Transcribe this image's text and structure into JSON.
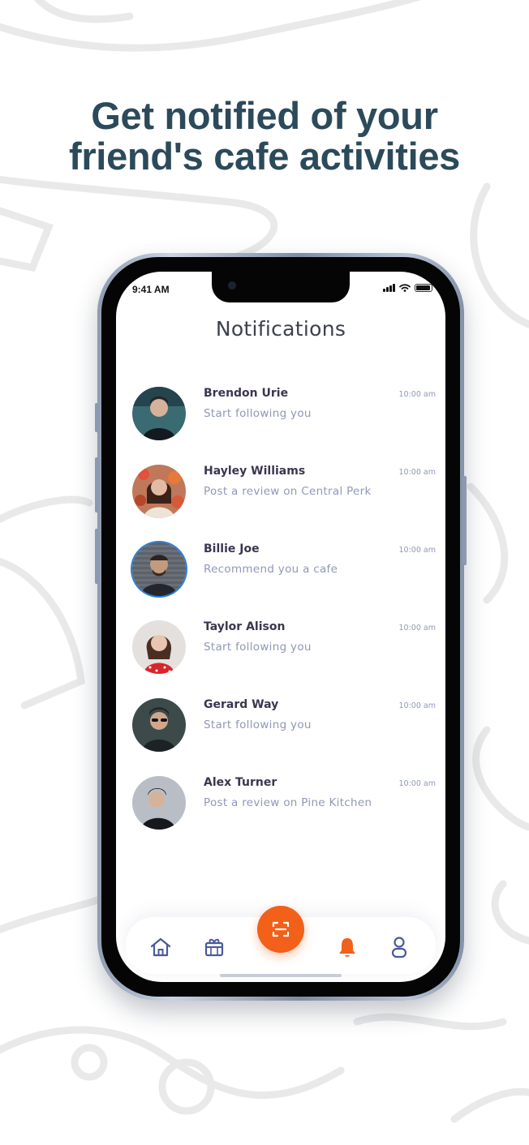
{
  "headline": {
    "line1": "Get notified of your",
    "line2": "friend's cafe activities"
  },
  "status_bar": {
    "time": "9:41 AM"
  },
  "screen": {
    "title": "Notifications"
  },
  "notifications": [
    {
      "name": "Brendon Urie",
      "message": "Start following you",
      "time": "10:00 am",
      "avatar": "person-portrait"
    },
    {
      "name": "Hayley Williams",
      "message": "Post a review on Central Perk",
      "time": "10:00 am",
      "avatar": "person-portrait"
    },
    {
      "name": "Billie Joe",
      "message": "Recommend you a cafe",
      "time": "10:00 am",
      "avatar": "person-portrait",
      "highlighted": true
    },
    {
      "name": "Taylor Alison",
      "message": "Start following you",
      "time": "10:00 am",
      "avatar": "person-portrait"
    },
    {
      "name": "Gerard Way",
      "message": "Start following you",
      "time": "10:00 am",
      "avatar": "person-portrait"
    },
    {
      "name": "Alex Turner",
      "message": "Post a review on Pine Kitchen",
      "time": "10:00 am",
      "avatar": "person-portrait"
    }
  ],
  "tab_bar": {
    "items": [
      "home-icon",
      "gift-icon",
      "scan-icon",
      "bell-icon",
      "profile-icon"
    ],
    "active": "bell-icon"
  },
  "colors": {
    "headline": "#2b4a5a",
    "accent": "#f2601a",
    "tab_icon": "#4a5a9a",
    "name_text": "#3c3550",
    "secondary_text": "#8f98b8"
  }
}
